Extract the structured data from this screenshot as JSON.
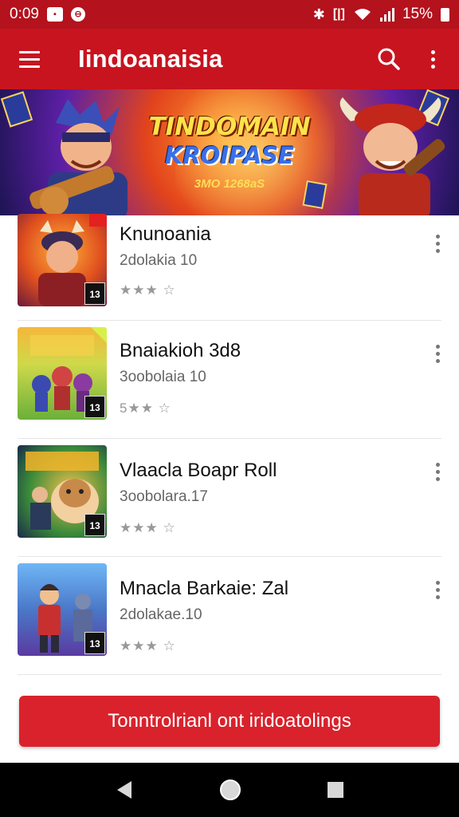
{
  "status_bar": {
    "time": "0:09",
    "battery": "15%",
    "icons": [
      "notification-icon",
      "circle-app-icon",
      "bluetooth-icon",
      "vibrate-icon",
      "wifi-icon",
      "signal-icon",
      "battery-icon"
    ]
  },
  "app_bar": {
    "title": "Iindoanaisia",
    "icons": [
      "menu-icon",
      "search-icon",
      "more-vert-icon"
    ]
  },
  "banner": {
    "title": "TINDOMAIN",
    "subtitle": "KROIPASE",
    "tagline": "3MO 1268aS"
  },
  "list": {
    "items": [
      {
        "title": "Knunoania",
        "subtitle": "2dolakia 10",
        "rating": "★★★ ☆",
        "badge": "13"
      },
      {
        "title": "Bnaiakioh 3d8",
        "subtitle": "3oobolaia 10",
        "rating": "5★★ ☆",
        "badge": "13"
      },
      {
        "title": "Vlaacla Boapr Roll",
        "subtitle": "3oobolara.17",
        "rating": "★★★ ☆",
        "badge": "13"
      },
      {
        "title": "Mnacla Barkaie: Zal",
        "subtitle": "2dolakae.10",
        "rating": "★★★ ☆",
        "badge": "13"
      }
    ]
  },
  "cta": {
    "label": "Tonntrolrianl ont iridoatolings"
  },
  "colors": {
    "primary": "#c8141f",
    "status_bar": "#b4121d",
    "cta": "#d9222c"
  }
}
